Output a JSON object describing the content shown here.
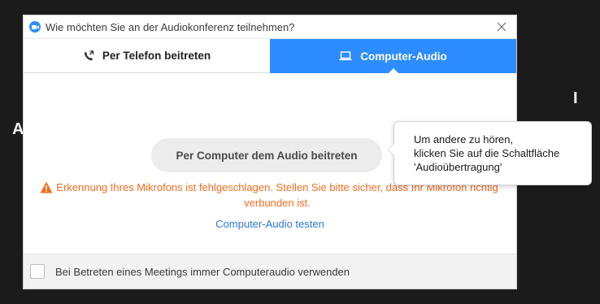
{
  "window": {
    "title": "Wie möchten Sie an der Audiokonferenz teilnehmen?",
    "close_icon": "close-icon",
    "app_icon": "zoom-app-icon"
  },
  "tabs": [
    {
      "label": "Per Telefon beitreten",
      "icon": "phone-icon",
      "active": false
    },
    {
      "label": "Computer-Audio",
      "icon": "laptop-icon",
      "active": true
    }
  ],
  "main": {
    "join_button_label": "Per Computer dem Audio beitreten",
    "warning_text": "Erkennung Ihres Mikrofons ist fehlgeschlagen. Stellen Sie bitte sicher, dass Ihr Mikrofon richtig verbunden ist.",
    "test_link_label": "Computer-Audio testen"
  },
  "footer": {
    "checkbox_label": "Bei Betreten eines Meetings immer Computeraudio verwenden",
    "checked": false
  },
  "tooltip": {
    "line1": "Um andere zu hören,",
    "line2": "klicken Sie auf die Schaltfläche",
    "line3": "'Audioübertragung'"
  },
  "colors": {
    "accent": "#2d8cff",
    "warning": "#f26d21",
    "link": "#2d78d6",
    "background": "#1b1b1b"
  }
}
